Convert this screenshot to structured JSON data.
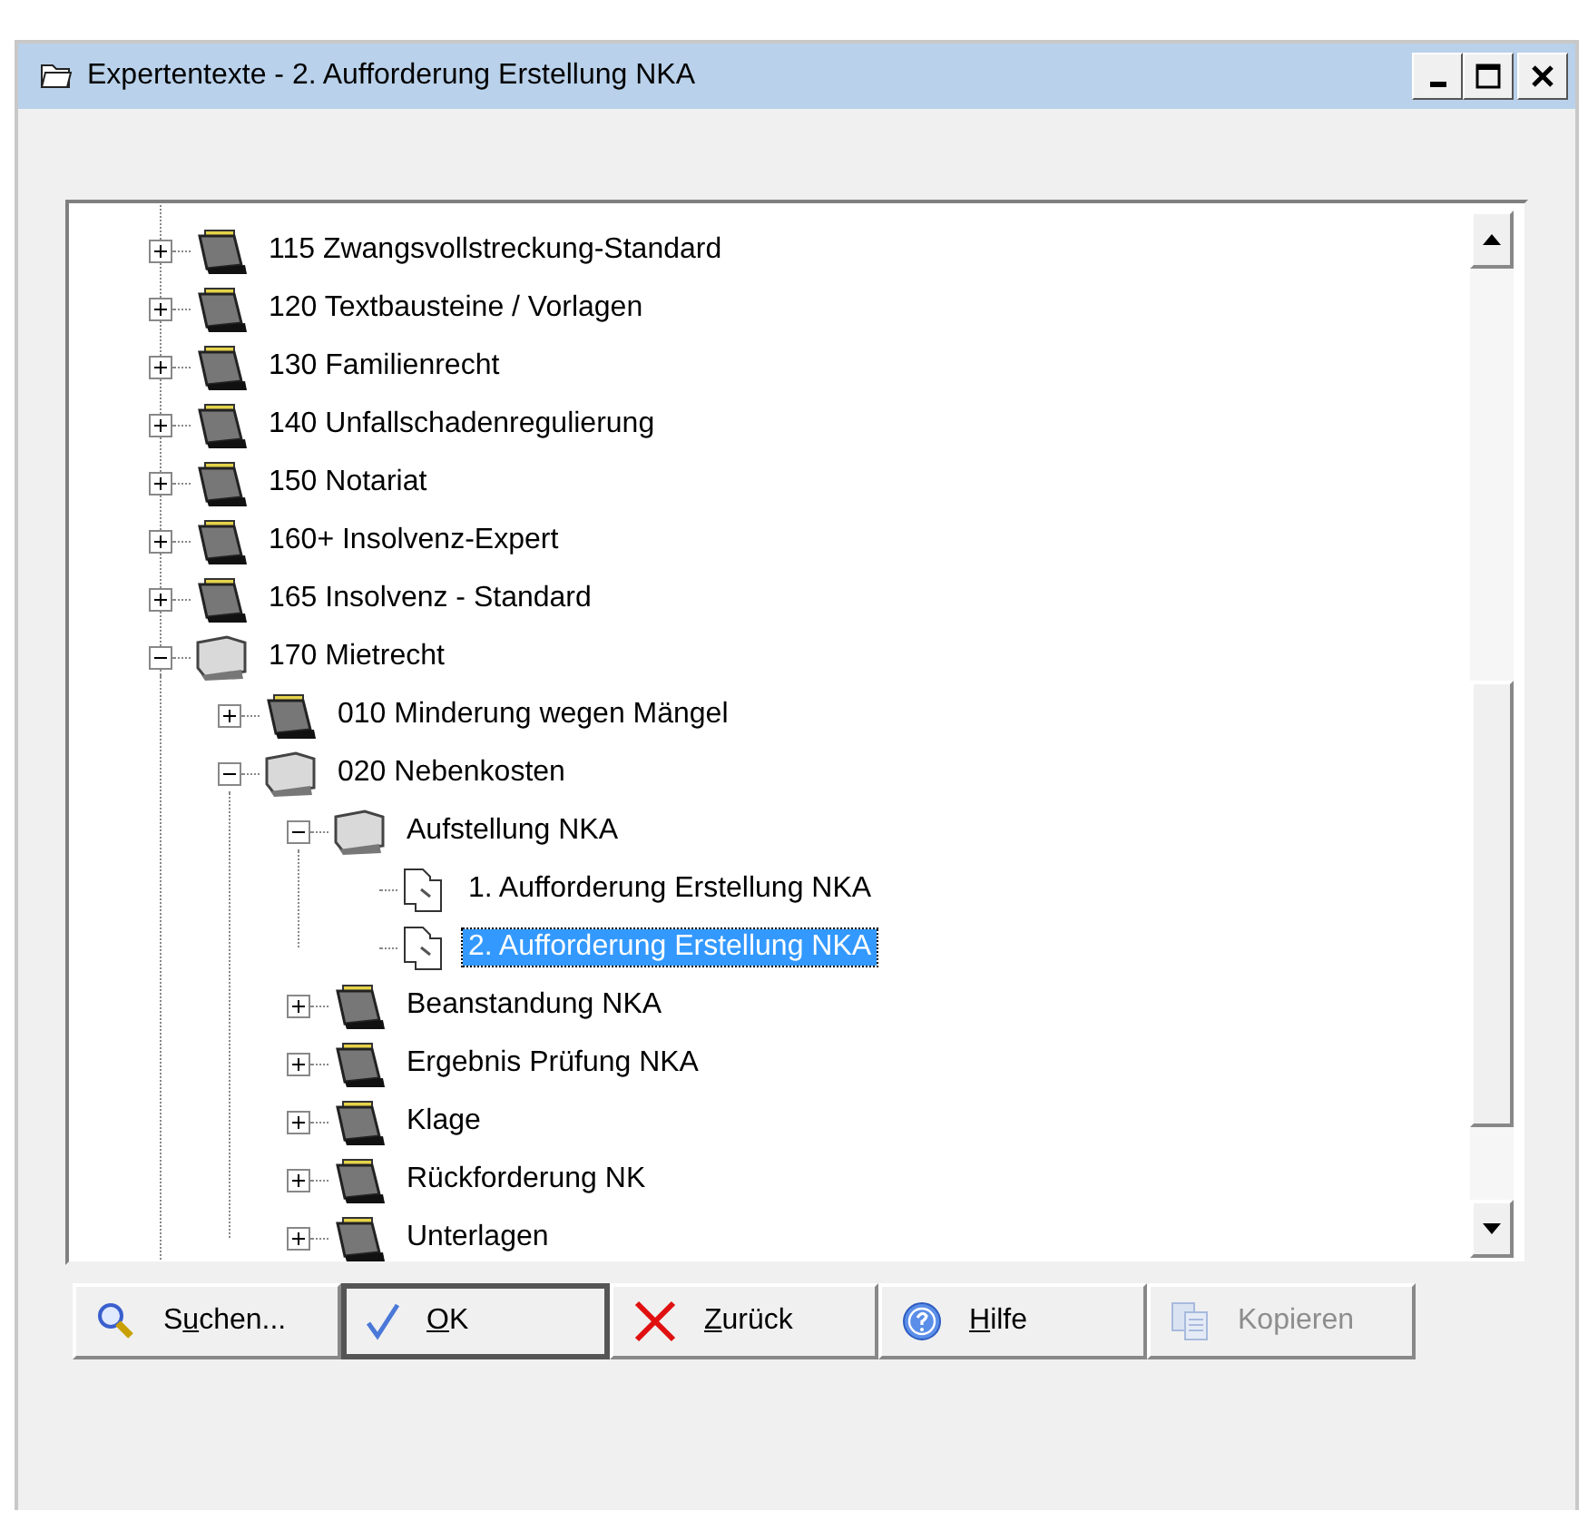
{
  "window": {
    "title": "Expertentexte - 2. Aufforderung Erstellung NKA"
  },
  "tree": [
    {
      "kind": "folder",
      "label": "115 Zwangsvollstreckung-Standard",
      "expanded": false,
      "selected": false
    },
    {
      "kind": "folder",
      "label": "120 Textbausteine / Vorlagen",
      "expanded": false,
      "selected": false
    },
    {
      "kind": "folder",
      "label": "130 Familienrecht",
      "expanded": false,
      "selected": false
    },
    {
      "kind": "folder",
      "label": "140 Unfallschadenregulierung",
      "expanded": false,
      "selected": false
    },
    {
      "kind": "folder",
      "label": "150 Notariat",
      "expanded": false,
      "selected": false
    },
    {
      "kind": "folder",
      "label": "160+ Insolvenz-Expert",
      "expanded": false,
      "selected": false
    },
    {
      "kind": "folder",
      "label": "165 Insolvenz - Standard",
      "expanded": false,
      "selected": false
    },
    {
      "kind": "folder",
      "label": "170 Mietrecht",
      "expanded": true,
      "selected": false,
      "children": [
        {
          "kind": "folder",
          "label": "010 Minderung wegen Mängel",
          "expanded": false,
          "selected": false
        },
        {
          "kind": "folder",
          "label": "020 Nebenkosten",
          "expanded": true,
          "selected": false,
          "children": [
            {
              "kind": "folder",
              "label": "Aufstellung NKA",
              "expanded": true,
              "selected": false,
              "children": [
                {
                  "kind": "document",
                  "label": "1. Aufforderung Erstellung NKA",
                  "selected": false
                },
                {
                  "kind": "document",
                  "label": "2. Aufforderung Erstellung NKA",
                  "selected": true
                }
              ]
            },
            {
              "kind": "folder",
              "label": "Beanstandung NKA",
              "expanded": false,
              "selected": false
            },
            {
              "kind": "folder",
              "label": "Ergebnis Prüfung NKA",
              "expanded": false,
              "selected": false
            },
            {
              "kind": "folder",
              "label": "Klage",
              "expanded": false,
              "selected": false
            },
            {
              "kind": "folder",
              "label": "Rückforderung NK",
              "expanded": false,
              "selected": false
            },
            {
              "kind": "folder",
              "label": "Unterlagen",
              "expanded": false,
              "selected": false
            }
          ]
        }
      ]
    }
  ],
  "buttons": [
    {
      "kind": "search",
      "label_start": "S",
      "access_key": "u",
      "label_end": "chen...",
      "default": false,
      "disabled": false
    },
    {
      "kind": "ok",
      "access_key": "O",
      "label_end": "K",
      "default": true,
      "disabled": false
    },
    {
      "kind": "back",
      "access_key": "Z",
      "label_end": "urück",
      "default": false,
      "disabled": false
    },
    {
      "kind": "help",
      "access_key": "H",
      "label_end": "ilfe",
      "default": false,
      "disabled": false
    },
    {
      "kind": "copy",
      "label": "Kopieren",
      "default": false,
      "disabled": true
    }
  ]
}
